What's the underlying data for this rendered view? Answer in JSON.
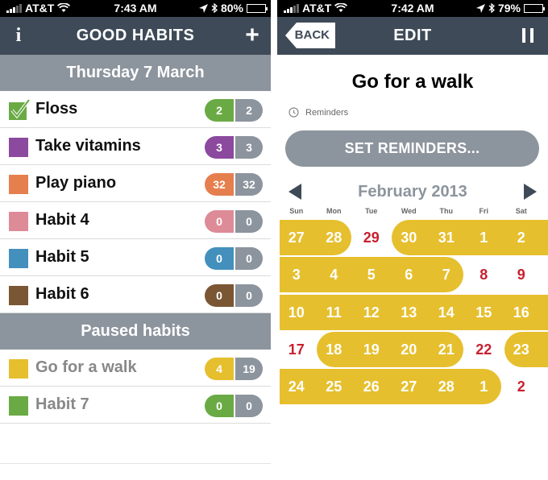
{
  "left_screen": {
    "status": {
      "carrier": "AT&T",
      "time": "7:43 AM",
      "battery": "80%",
      "battery_level": 0.8
    },
    "nav": {
      "title": "GOOD HABITS",
      "info_label": "i",
      "add_label": "+"
    },
    "day_header": "Thursday 7 March",
    "habits": [
      {
        "name": "Floss",
        "color": "#6aaa45",
        "checked": true,
        "current": "2",
        "best": "2"
      },
      {
        "name": "Take vitamins",
        "color": "#8b4a9e",
        "checked": false,
        "current": "3",
        "best": "3"
      },
      {
        "name": "Play piano",
        "color": "#e67f4e",
        "checked": false,
        "current": "32",
        "best": "32"
      },
      {
        "name": "Habit 4",
        "color": "#de8b98",
        "checked": false,
        "current": "0",
        "best": "0"
      },
      {
        "name": "Habit 5",
        "color": "#4390bd",
        "checked": false,
        "current": "0",
        "best": "0"
      },
      {
        "name": "Habit 6",
        "color": "#7a5634",
        "checked": false,
        "current": "0",
        "best": "0"
      }
    ],
    "paused_header": "Paused habits",
    "paused_habits": [
      {
        "name": "Go for a walk",
        "color": "#e6bf2e",
        "current": "4",
        "best": "19"
      },
      {
        "name": "Habit 7",
        "color": "#6aaa45",
        "current": "0",
        "best": "0"
      }
    ]
  },
  "right_screen": {
    "status": {
      "carrier": "AT&T",
      "time": "7:42 AM",
      "battery": "79%",
      "battery_level": 0.79
    },
    "nav": {
      "back_label": "BACK",
      "title": "EDIT"
    },
    "habit_title": "Go for a walk",
    "reminders_label": "Reminders",
    "set_reminders_label": "SET REMINDERS...",
    "calendar": {
      "month": "February 2013",
      "weekdays": [
        "Sun",
        "Mon",
        "Tue",
        "Wed",
        "Thu",
        "Fri",
        "Sat"
      ],
      "accent": "#e6bf2e",
      "missed_color": "#c8202f",
      "weeks": [
        [
          {
            "d": "27",
            "done": true
          },
          {
            "d": "28",
            "done": true
          },
          {
            "d": "29",
            "done": false
          },
          {
            "d": "30",
            "done": true
          },
          {
            "d": "31",
            "done": true
          },
          {
            "d": "1",
            "done": true
          },
          {
            "d": "2",
            "done": true
          }
        ],
        [
          {
            "d": "3",
            "done": true
          },
          {
            "d": "4",
            "done": true
          },
          {
            "d": "5",
            "done": true
          },
          {
            "d": "6",
            "done": true
          },
          {
            "d": "7",
            "done": true
          },
          {
            "d": "8",
            "done": false
          },
          {
            "d": "9",
            "done": false
          }
        ],
        [
          {
            "d": "10",
            "done": true
          },
          {
            "d": "11",
            "done": true
          },
          {
            "d": "12",
            "done": true
          },
          {
            "d": "13",
            "done": true
          },
          {
            "d": "14",
            "done": true
          },
          {
            "d": "15",
            "done": true
          },
          {
            "d": "16",
            "done": true
          }
        ],
        [
          {
            "d": "17",
            "done": false
          },
          {
            "d": "18",
            "done": true
          },
          {
            "d": "19",
            "done": true
          },
          {
            "d": "20",
            "done": true
          },
          {
            "d": "21",
            "done": true
          },
          {
            "d": "22",
            "done": false
          },
          {
            "d": "23",
            "done": true
          }
        ],
        [
          {
            "d": "24",
            "done": true
          },
          {
            "d": "25",
            "done": true
          },
          {
            "d": "26",
            "done": true
          },
          {
            "d": "27",
            "done": true
          },
          {
            "d": "28",
            "done": true
          },
          {
            "d": "1",
            "done": true
          },
          {
            "d": "2",
            "done": false
          }
        ]
      ]
    }
  },
  "colors": {
    "navbar": "#3e4a57",
    "header_gray": "#8c949d"
  }
}
